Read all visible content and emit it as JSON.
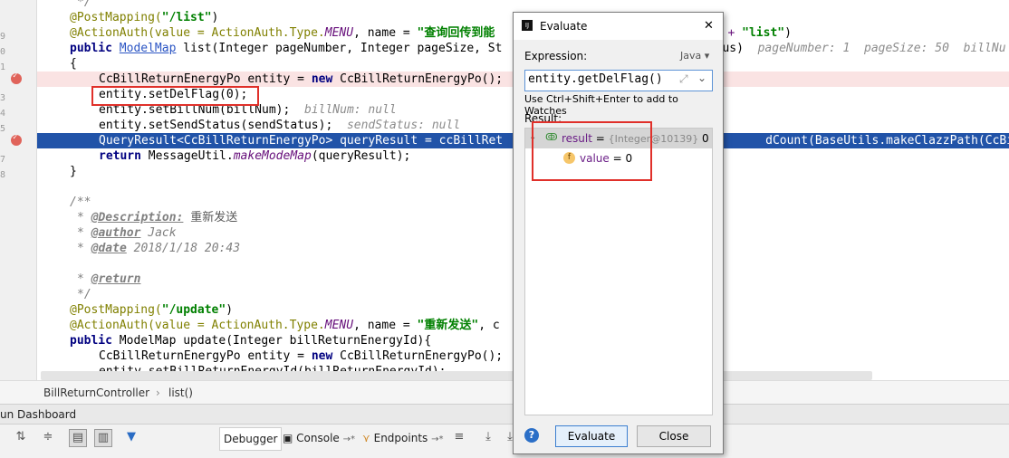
{
  "editor": {
    "line_numbers": [
      "",
      "3",
      "9",
      "0",
      "1",
      "2",
      "3",
      "4",
      "5",
      "6",
      "7",
      "8",
      "",
      "",
      "",
      "",
      "",
      "",
      "",
      "",
      "",
      "",
      "",
      "",
      ""
    ],
    "lines": {
      "l1": "*/",
      "l2a": "@PostMapping(",
      "l2b": "\"/list\"",
      "l2c": ")",
      "l3a": "@ActionAuth(value = ActionAuth.Type.",
      "l3b": "MENU",
      "l3c": ", name = ",
      "l3d": "\"查询回传到能",
      "l3e": "ROOT + ",
      "l3f": "\"list\"",
      "l3g": ")",
      "l4a": "public ",
      "l4b": "ModelMap",
      "l4c": " list(Integer pageNumber, Integer pageSize, St",
      "l4d": "us)",
      "l4e": "pageNumber: 1  pageSize: 50  billNu",
      "l5": "{",
      "l6a": "CcBillReturnEnergyPo entity = ",
      "l6b": "new",
      "l6c": " CcBillReturnEnergyPo();",
      "l7": "entity.setDelFlag(0);",
      "l8a": "entity.setBillNum(billNum);",
      "l8b": "billNum: null",
      "l9a": "entity.setSendStatus(sendStatus);",
      "l9b": "sendStatus: null",
      "l10a": "QueryResult<CcBillReturnEnergyPo> queryResult = ccBillRet",
      "l10b": "dCount(BaseUtils.makeClazzPath(CcBillRet",
      "l11a": "return",
      "l11b": " MessageUtil.",
      "l11c": "makeModeMap",
      "l11d": "(queryResult);",
      "l12": "}",
      "l14": "/**",
      "l15a": "* ",
      "l15b": "@Description:",
      "l15c": " 重新发送",
      "l16a": "* ",
      "l16b": "@author",
      "l16c": " Jack",
      "l17a": "* ",
      "l17b": "@date",
      "l17c": " 2018/1/18 20:43",
      "l19a": "* ",
      "l19b": "@return",
      "l20": "*/",
      "l21a": "@PostMapping(",
      "l21b": "\"/update\"",
      "l21c": ")",
      "l22a": "@ActionAuth(value = ActionAuth.Type.",
      "l22b": "MENU",
      "l22c": ", name = ",
      "l22d": "\"重新发送\"",
      "l22e": ", c",
      "l23a": "public",
      "l23b": " ModelMap update(Integer billReturnEnergyId){",
      "l24a": "CcBillReturnEnergyPo entity = ",
      "l24b": "new",
      "l24c": " CcBillReturnEnergyPo();",
      "l25": "entity.setBillReturnEnergyId(billReturnEnergyId);"
    }
  },
  "breadcrumb": {
    "item1": "BillReturnController",
    "sep": "›",
    "item2": "list()"
  },
  "dashboard": {
    "label": "un Dashboard"
  },
  "toolbar": {
    "tabs": {
      "debugger": "Debugger",
      "console": "Console",
      "console_arrow": "→*",
      "endpoints": "Endpoints",
      "endpoints_arrow": "→*"
    },
    "icons": [
      "restore-layout-icon",
      "scroll-up-icon",
      "scroll-down-icon",
      "frames-icon",
      "threads-icon",
      "filter-icon",
      "step-over-icon",
      "step-into-icon",
      "force-step-icon"
    ]
  },
  "dialog": {
    "title": "Evaluate",
    "close": "✕",
    "expression_label": "Expression:",
    "language": "Java ▾",
    "expression_value": "entity.getDelFlag()",
    "hint": "Use Ctrl+Shift+Enter to add to Watches",
    "result_label": "Result:",
    "tree": {
      "result_name": "result",
      "result_eq": " = ",
      "result_type": "{Integer@10139}",
      "result_value": " 0",
      "child_name": "value",
      "child_eq": " = 0"
    },
    "help": "?",
    "evaluate_button": "Evaluate",
    "close_button": "Close"
  },
  "colors": {
    "selection": "#2153a8",
    "breakpoint": "#e0635a",
    "highlight_box": "#e0302a",
    "accent": "#5d93d6"
  }
}
